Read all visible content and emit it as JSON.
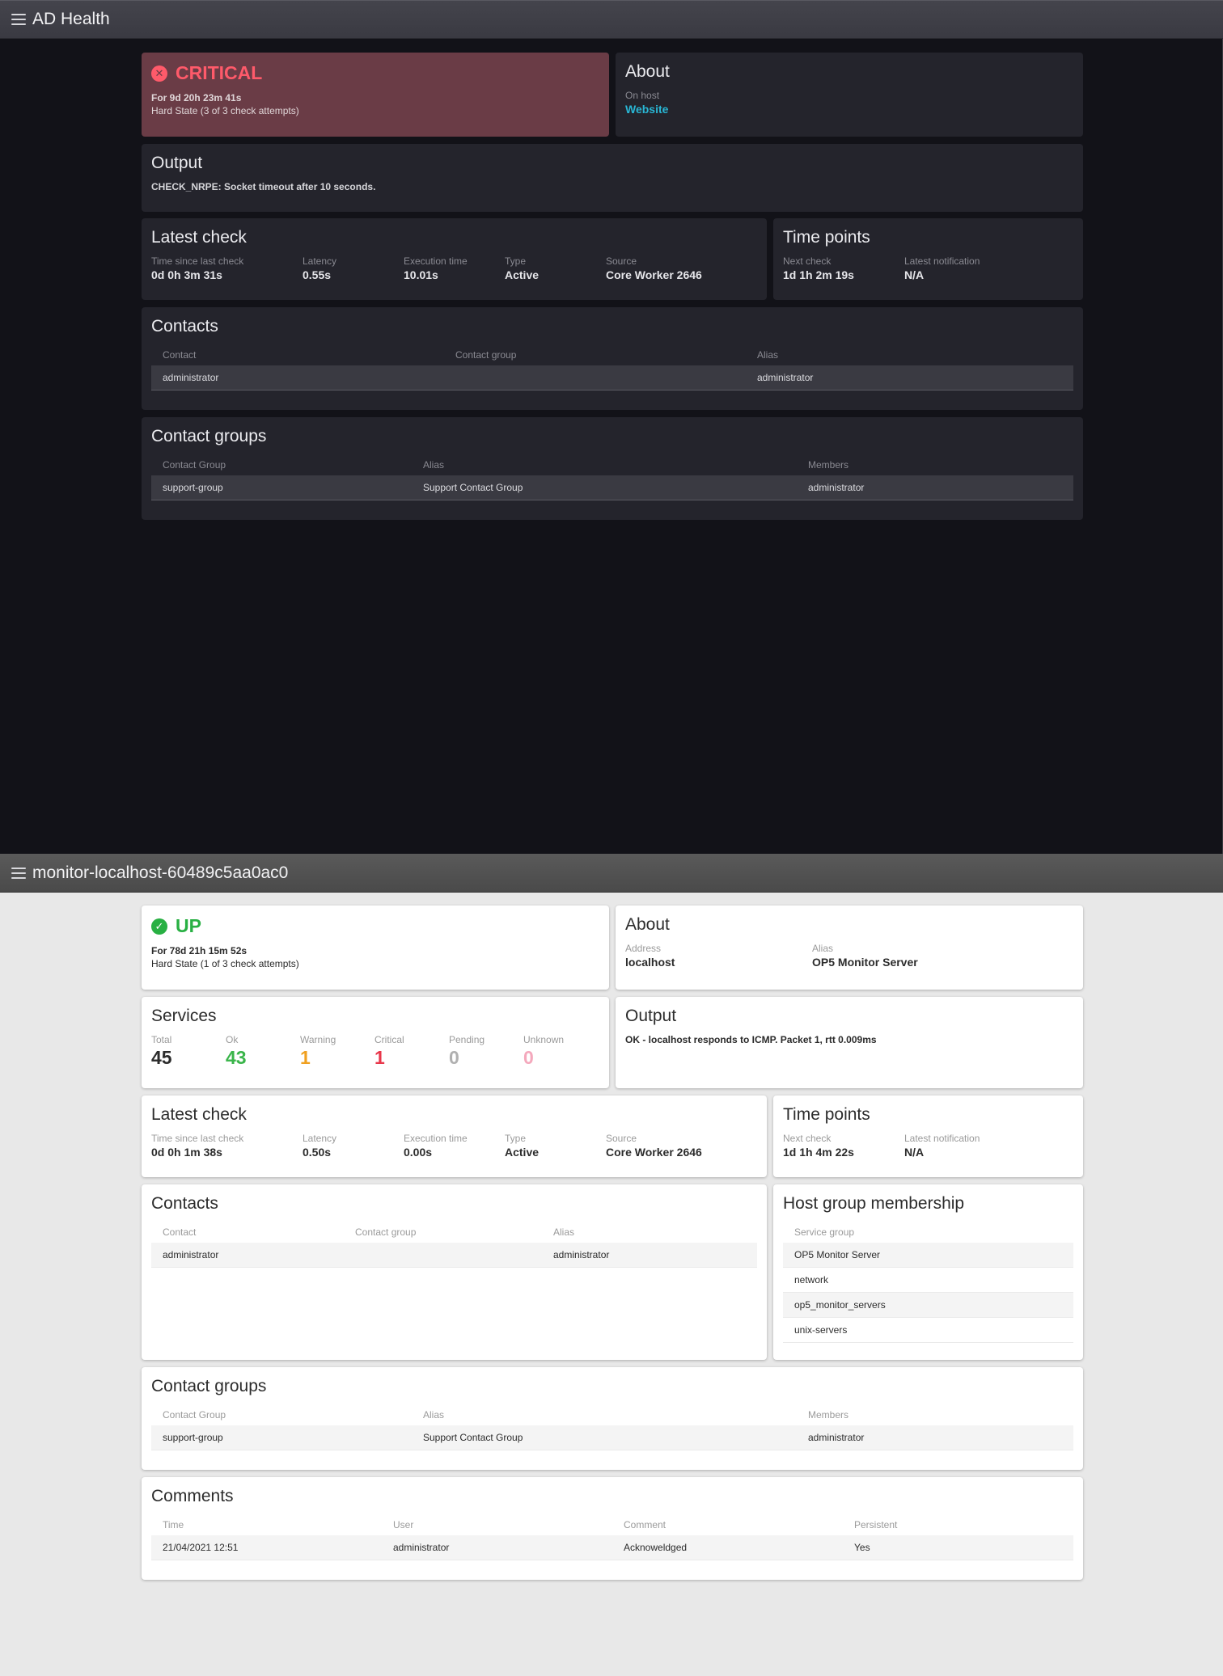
{
  "panel1": {
    "title": "AD Health",
    "state": {
      "label": "CRITICAL",
      "duration": "For 9d 20h 23m 41s",
      "hard_state": "Hard State (3 of 3 check attempts)"
    },
    "about": {
      "title": "About",
      "on_host_label": "On host",
      "host_link": "Website"
    },
    "output": {
      "title": "Output",
      "text": "CHECK_NRPE: Socket timeout after 10 seconds."
    },
    "latest_check": {
      "title": "Latest check",
      "fields": [
        {
          "label": "Time since last check",
          "value": "0d 0h 3m 31s"
        },
        {
          "label": "Latency",
          "value": "0.55s"
        },
        {
          "label": "Execution time",
          "value": "10.01s"
        },
        {
          "label": "Type",
          "value": "Active"
        },
        {
          "label": "Source",
          "value": "Core Worker 2646"
        }
      ]
    },
    "time_points": {
      "title": "Time points",
      "fields": [
        {
          "label": "Next check",
          "value": "1d 1h 2m 19s"
        },
        {
          "label": "Latest notification",
          "value": "N/A"
        }
      ]
    },
    "contacts": {
      "title": "Contacts",
      "headers": [
        "Contact",
        "Contact group",
        "Alias"
      ],
      "rows": [
        [
          "administrator",
          "",
          "administrator"
        ]
      ]
    },
    "contact_groups": {
      "title": "Contact groups",
      "headers": [
        "Contact Group",
        "Alias",
        "Members"
      ],
      "rows": [
        [
          "support-group",
          "Support Contact Group",
          "administrator"
        ]
      ]
    }
  },
  "panel2": {
    "title": "monitor-localhost-60489c5aa0ac0",
    "state": {
      "label": "UP",
      "duration": "For 78d 21h 15m 52s",
      "hard_state": "Hard State (1 of 3 check attempts)"
    },
    "about": {
      "title": "About",
      "fields": [
        {
          "label": "Address",
          "value": "localhost"
        },
        {
          "label": "Alias",
          "value": "OP5 Monitor Server"
        }
      ]
    },
    "services": {
      "title": "Services",
      "items": [
        {
          "label": "Total",
          "value": "45",
          "color": "#2c2c2c"
        },
        {
          "label": "Ok",
          "value": "43",
          "color": "#3ab54a"
        },
        {
          "label": "Warning",
          "value": "1",
          "color": "#f0a020"
        },
        {
          "label": "Critical",
          "value": "1",
          "color": "#e8364a"
        },
        {
          "label": "Pending",
          "value": "0",
          "color": "#b0b0b0"
        },
        {
          "label": "Unknown",
          "value": "0",
          "color": "#f4a8bc"
        }
      ]
    },
    "output": {
      "title": "Output",
      "text": "OK - localhost responds to ICMP. Packet 1, rtt 0.009ms"
    },
    "latest_check": {
      "title": "Latest check",
      "fields": [
        {
          "label": "Time since last check",
          "value": "0d 0h 1m 38s"
        },
        {
          "label": "Latency",
          "value": "0.50s"
        },
        {
          "label": "Execution time",
          "value": "0.00s"
        },
        {
          "label": "Type",
          "value": "Active"
        },
        {
          "label": "Source",
          "value": "Core Worker 2646"
        }
      ]
    },
    "time_points": {
      "title": "Time points",
      "fields": [
        {
          "label": "Next check",
          "value": "1d 1h 4m 22s"
        },
        {
          "label": "Latest notification",
          "value": "N/A"
        }
      ]
    },
    "contacts": {
      "title": "Contacts",
      "headers": [
        "Contact",
        "Contact group",
        "Alias"
      ],
      "rows": [
        [
          "administrator",
          "",
          "administrator"
        ]
      ]
    },
    "host_groups": {
      "title": "Host group membership",
      "header": "Service group",
      "rows": [
        "OP5 Monitor Server",
        "network",
        "op5_monitor_servers",
        "unix-servers"
      ]
    },
    "contact_groups": {
      "title": "Contact groups",
      "headers": [
        "Contact Group",
        "Alias",
        "Members"
      ],
      "rows": [
        [
          "support-group",
          "Support Contact Group",
          "administrator"
        ]
      ]
    },
    "comments": {
      "title": "Comments",
      "headers": [
        "Time",
        "User",
        "Comment",
        "Persistent"
      ],
      "rows": [
        [
          "21/04/2021 12:51",
          "administrator",
          "Acknoweldged",
          "Yes"
        ]
      ]
    }
  }
}
